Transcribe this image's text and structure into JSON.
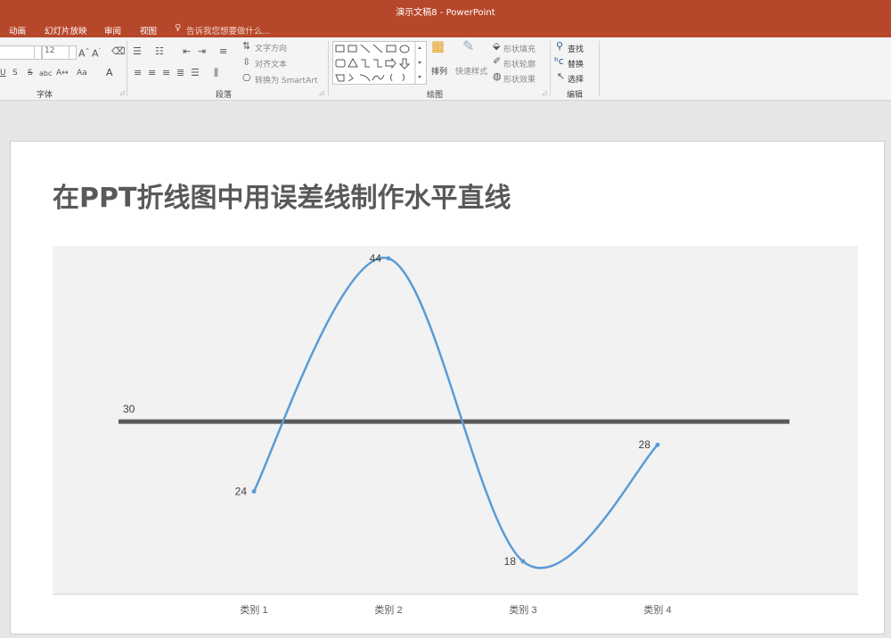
{
  "app": {
    "window_title": "演示文稿8 - PowerPoint"
  },
  "tabs": [
    {
      "label": "动画"
    },
    {
      "label": "幻灯片放映"
    },
    {
      "label": "审阅"
    },
    {
      "label": "视图"
    }
  ],
  "tell_me": {
    "placeholder": "告诉我您想要做什么..."
  },
  "ribbon": {
    "font": {
      "size_value": "12",
      "group_label": "字体"
    },
    "paragraph": {
      "text_direction": "文字方向",
      "align_text": "对齐文本",
      "smartart": "转换为 SmartArt",
      "group_label": "段落"
    },
    "drawing": {
      "arrange": "排列",
      "quick_styles": "快速样式",
      "shape_fill": "形状填充",
      "shape_outline": "形状轮廓",
      "shape_effects": "形状效果",
      "group_label": "绘图"
    },
    "editing": {
      "find": "查找",
      "replace": "替换",
      "select": "选择",
      "group_label": "编辑"
    }
  },
  "slide": {
    "title": "在PPT折线图中用误差线制作水平直线"
  },
  "chart_data": {
    "type": "line",
    "categories": [
      "类别 1",
      "类别 2",
      "类别 3",
      "类别 4"
    ],
    "series": [
      {
        "values": [
          24,
          44,
          18,
          28
        ],
        "color": "#5b9bd5",
        "smooth": true,
        "data_labels": [
          "24",
          "44",
          "18",
          "28"
        ]
      }
    ],
    "reference_line": {
      "value": 30,
      "label": "30",
      "color": "#595959"
    },
    "ylim": [
      15,
      45
    ],
    "plot_background": "#f2f2f2",
    "grid": false,
    "legend": "none"
  }
}
